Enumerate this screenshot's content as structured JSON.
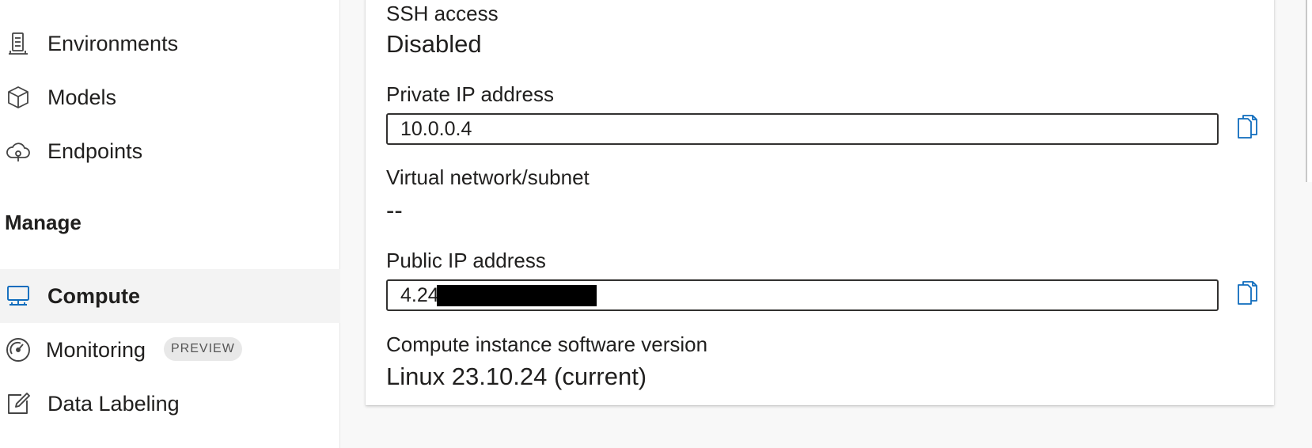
{
  "sidebar": {
    "items": [
      {
        "label": "Environments",
        "icon": "environments-icon"
      },
      {
        "label": "Models",
        "icon": "cube-icon"
      },
      {
        "label": "Endpoints",
        "icon": "cloud-endpoint-icon"
      }
    ],
    "manage_header": "Manage",
    "manage_items": [
      {
        "label": "Compute",
        "icon": "monitor-icon",
        "active": true
      },
      {
        "label": "Monitoring",
        "icon": "gauge-icon",
        "badge": "PREVIEW"
      },
      {
        "label": "Data Labeling",
        "icon": "edit-icon"
      }
    ]
  },
  "details": {
    "ssh": {
      "label": "SSH access",
      "value": "Disabled"
    },
    "private_ip": {
      "label": "Private IP address",
      "value": "10.0.0.4"
    },
    "vnet": {
      "label": "Virtual network/subnet",
      "value": "--"
    },
    "public_ip": {
      "label": "Public IP address",
      "value": "4.24"
    },
    "software": {
      "label": "Compute instance software version",
      "value": "Linux 23.10.24 (current)"
    }
  },
  "colors": {
    "accent": "#0f6cbd",
    "active_bg": "#f3f3f3"
  }
}
